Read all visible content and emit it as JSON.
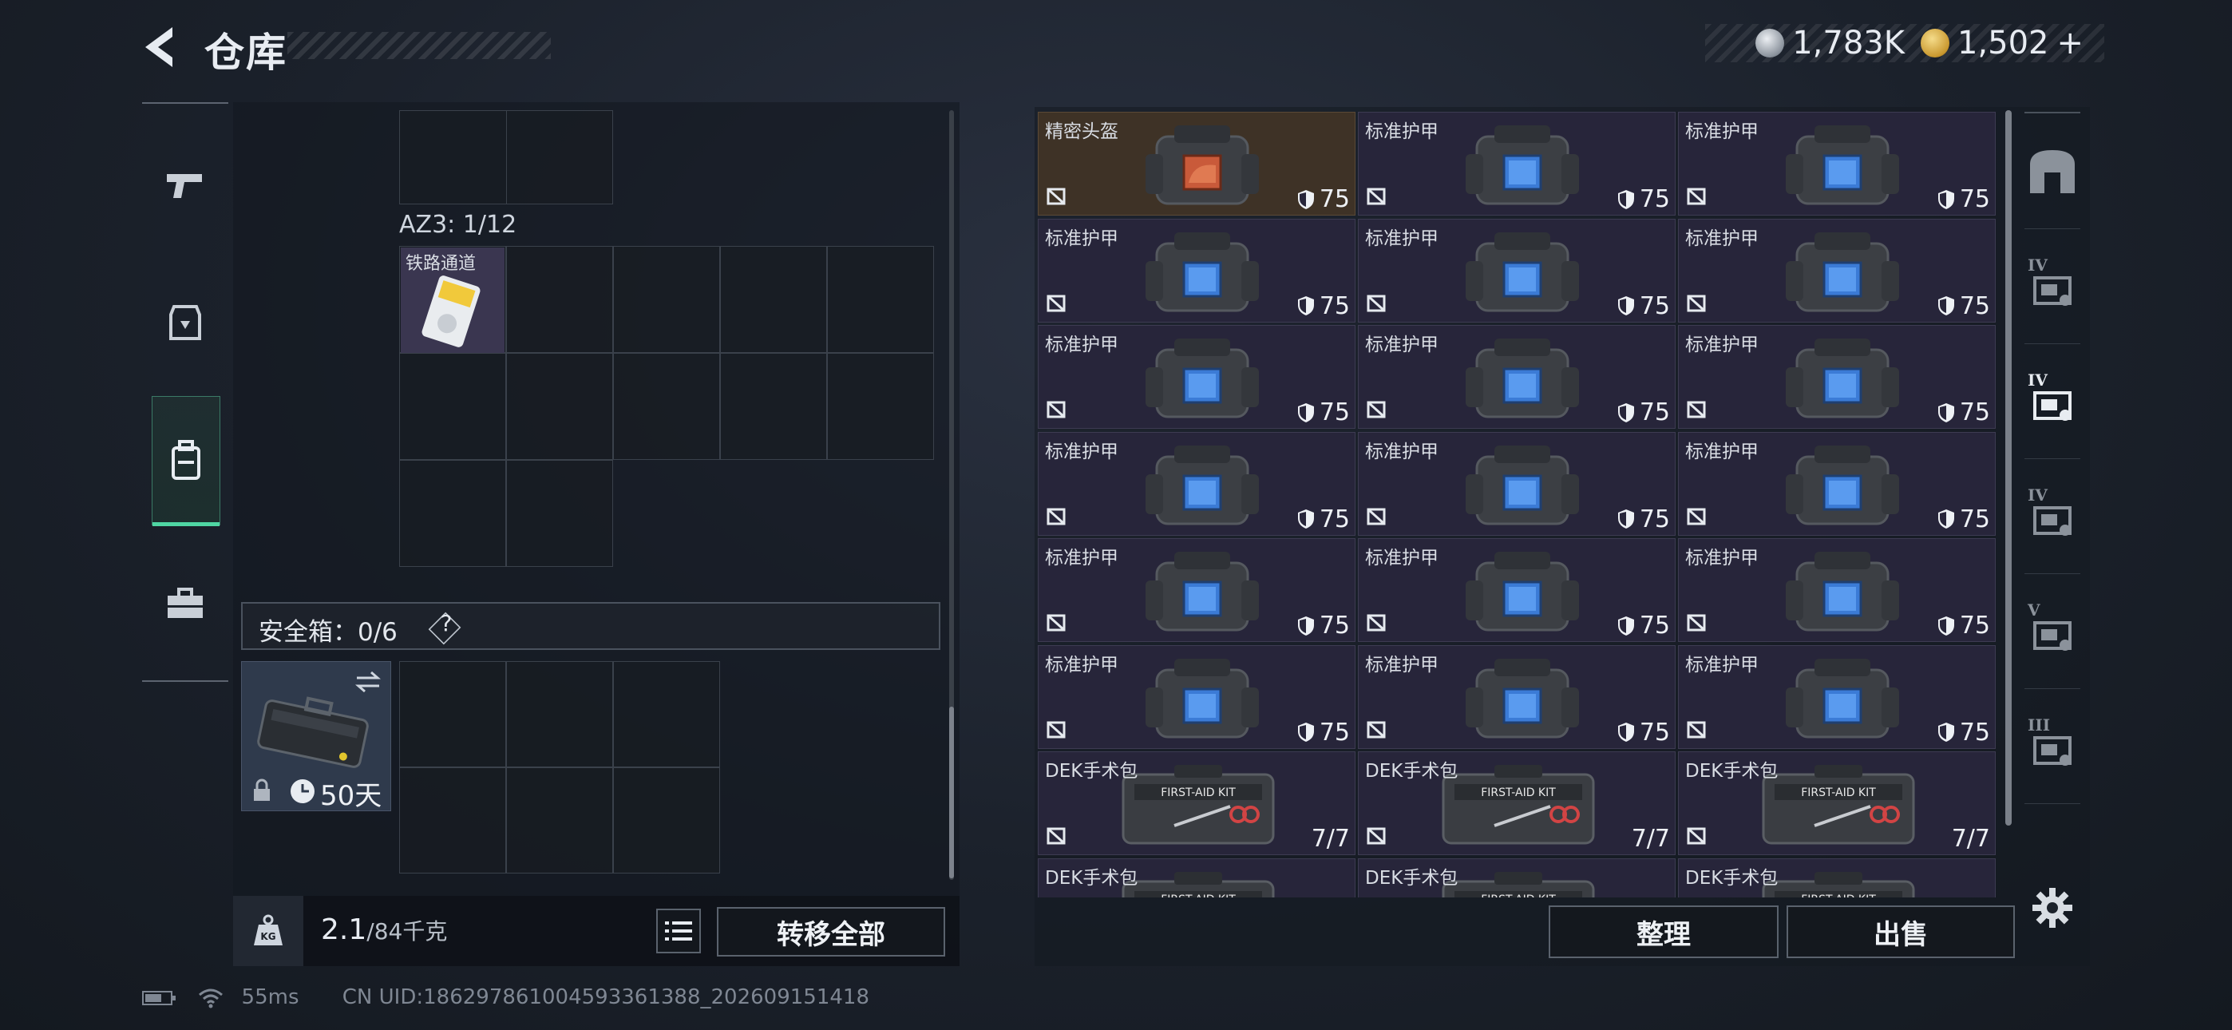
{
  "header": {
    "title": "仓库"
  },
  "currency": {
    "silver": "1,783K",
    "gold": "1,502",
    "plus": "+"
  },
  "left_tabs": [
    {
      "name": "weapon",
      "icon": "pistol-icon"
    },
    {
      "name": "armor",
      "icon": "helmet-icon"
    },
    {
      "name": "backpack",
      "icon": "backpack-icon",
      "active": true
    },
    {
      "name": "case",
      "icon": "briefcase-icon"
    }
  ],
  "storage": {
    "az3_label": "AZ3: 1/12",
    "item_name": "铁路通道"
  },
  "safe": {
    "label": "安全箱：0/6",
    "help": "?",
    "days": "50天"
  },
  "footer": {
    "weight_value": "2.1",
    "weight_max": "/84千克",
    "transfer_all": "转移全部",
    "tidy": "整理",
    "sell": "出售"
  },
  "items": [
    {
      "name": "精密头盔",
      "value": "75",
      "kind": "helmet"
    },
    {
      "name": "标准护甲",
      "value": "75",
      "kind": "armor"
    },
    {
      "name": "标准护甲",
      "value": "75",
      "kind": "armor"
    },
    {
      "name": "标准护甲",
      "value": "75",
      "kind": "armor"
    },
    {
      "name": "标准护甲",
      "value": "75",
      "kind": "armor"
    },
    {
      "name": "标准护甲",
      "value": "75",
      "kind": "armor"
    },
    {
      "name": "标准护甲",
      "value": "75",
      "kind": "armor"
    },
    {
      "name": "标准护甲",
      "value": "75",
      "kind": "armor"
    },
    {
      "name": "标准护甲",
      "value": "75",
      "kind": "armor"
    },
    {
      "name": "标准护甲",
      "value": "75",
      "kind": "armor"
    },
    {
      "name": "标准护甲",
      "value": "75",
      "kind": "armor"
    },
    {
      "name": "标准护甲",
      "value": "75",
      "kind": "armor"
    },
    {
      "name": "标准护甲",
      "value": "75",
      "kind": "armor"
    },
    {
      "name": "标准护甲",
      "value": "75",
      "kind": "armor"
    },
    {
      "name": "标准护甲",
      "value": "75",
      "kind": "armor"
    },
    {
      "name": "标准护甲",
      "value": "75",
      "kind": "armor"
    },
    {
      "name": "标准护甲",
      "value": "75",
      "kind": "armor"
    },
    {
      "name": "标准护甲",
      "value": "75",
      "kind": "armor"
    },
    {
      "name": "DEK手术包",
      "value": "7/7",
      "kind": "medkit"
    },
    {
      "name": "DEK手术包",
      "value": "7/7",
      "kind": "medkit"
    },
    {
      "name": "DEK手术包",
      "value": "7/7",
      "kind": "medkit"
    },
    {
      "name": "DEK手术包",
      "value": "",
      "kind": "medkit"
    },
    {
      "name": "DEK手术包",
      "value": "",
      "kind": "medkit"
    },
    {
      "name": "DEK手术包",
      "value": "",
      "kind": "medkit"
    }
  ],
  "medkit_text": "FIRST-AID KIT",
  "right_tabs": [
    {
      "icon": "shelter-icon",
      "tier": ""
    },
    {
      "icon": "folder-icon",
      "tier": "IV"
    },
    {
      "icon": "vehicle-icon",
      "tier": "IV"
    },
    {
      "icon": "radio-icon",
      "tier": "IV"
    },
    {
      "icon": "radio-icon-2",
      "tier": "V"
    },
    {
      "icon": "tank-icon",
      "tier": "III"
    }
  ],
  "status": {
    "ping": "55ms",
    "uid": "CN UID:1862978610045933613​88_202609151418"
  }
}
